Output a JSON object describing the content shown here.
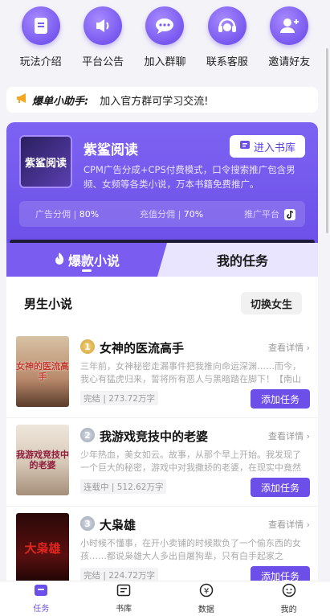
{
  "top_icons": [
    {
      "label": "玩法介绍",
      "icon": "bookmark-icon"
    },
    {
      "label": "平台公告",
      "icon": "speaker-icon"
    },
    {
      "label": "加入群聊",
      "icon": "chat-bubble-icon"
    },
    {
      "label": "联系客服",
      "icon": "headset-icon"
    },
    {
      "label": "邀请好友",
      "icon": "add-user-icon"
    }
  ],
  "notice": {
    "tag": "爆单小助手:",
    "message": "加入官方群可学习交流!"
  },
  "app_card": {
    "cover_text": "紫鲨阅读",
    "name": "紫鲨阅读",
    "enter_label": "进入书库",
    "description": "CPM广告分成+CPS付费模式，口令搜索推广包含男频、女频等各类小说，万本书籍免费推广。",
    "stats": [
      {
        "label": "广告分佣",
        "value": "80%"
      },
      {
        "label": "充值分佣",
        "value": "70%"
      },
      {
        "label": "推广平台",
        "value": ""
      }
    ]
  },
  "tabs": {
    "active": "爆款小说",
    "other": "我的任务"
  },
  "list": {
    "title": "男生小说",
    "switch_label": "切换女生",
    "detail_label": "查看详情",
    "add_label": "添加任务",
    "books": [
      {
        "rank": "1",
        "title": "女神的医流高手",
        "cover_text": "女神的医流高手",
        "desc": "三年前，女神秘密走漏事件把我推向命运深渊……而今，我心有猛虎归来，誓将所有恶人与黑暗踏在脚下！【南山有猛…",
        "meta": "完结 | 273.72万字"
      },
      {
        "rank": "2",
        "title": "我游戏竞技中的老婆",
        "cover_text": "我游戏竞技中的老婆",
        "desc": "少年热血，美女如云。故事，从那个早上开始。我发现了一个巨大的秘密，游戏中对我撒娇的老婆，在现实中竟然是我的…",
        "meta": "连载中 | 512.62万字"
      },
      {
        "rank": "3",
        "title": "大枭雄",
        "cover_text": "大枭雄",
        "desc": "小时候不懂事，在开小卖铺的时候欺负了一个偷东西的女孩……都说枭雄大人多出自屠狗辈，只有白手起家之人，…",
        "meta": "完结 | 224.72万字"
      }
    ]
  },
  "bottom_nav": [
    {
      "label": "任务",
      "icon": "task-icon"
    },
    {
      "label": "书库",
      "icon": "library-icon"
    },
    {
      "label": "数据",
      "icon": "data-yen-icon"
    },
    {
      "label": "我的",
      "icon": "profile-icon"
    }
  ]
}
